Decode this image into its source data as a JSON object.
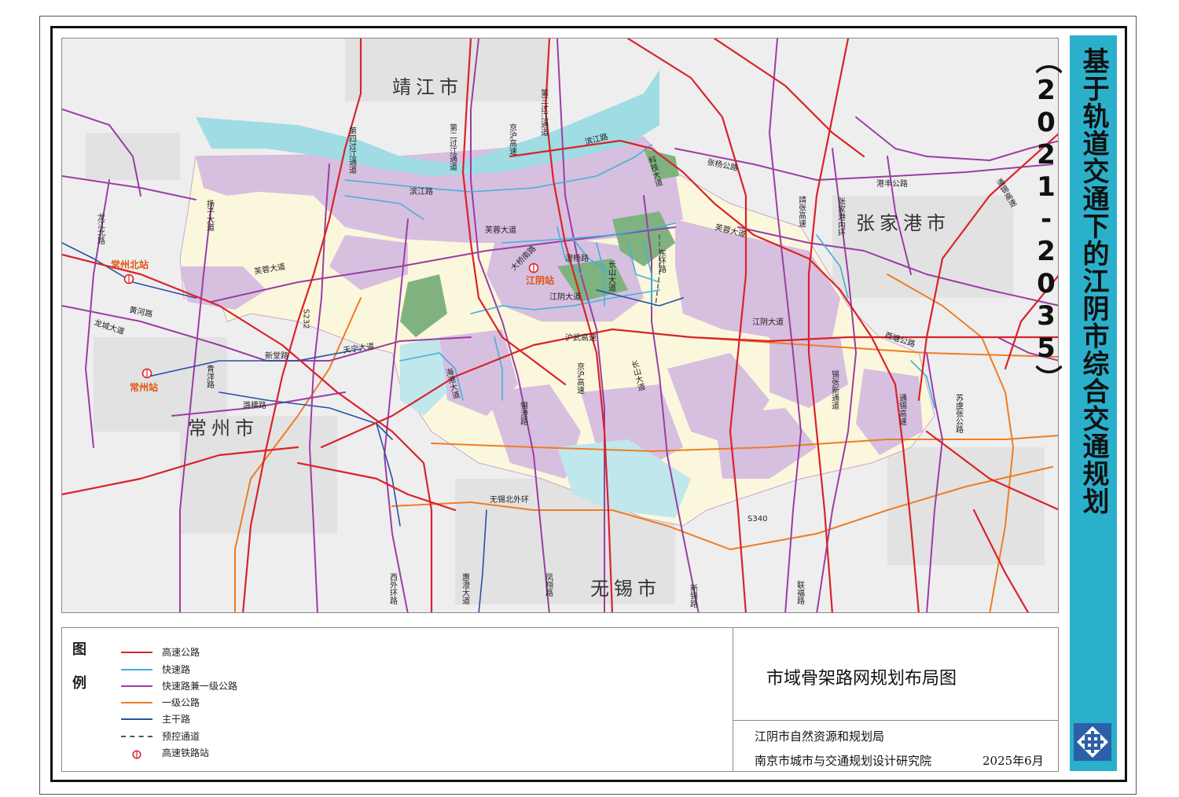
{
  "title": "基于轨道交通下的江阴市综合交通规划（2021-2035）",
  "map_title": "市域骨架路网规划布局图",
  "credits": {
    "org1": "江阴市自然资源和规划局",
    "org2": "南京市城市与交通规划设计研究院",
    "date": "2025年6月"
  },
  "legend": {
    "heading_1": "图",
    "heading_2": "例",
    "items": [
      {
        "label": "高速公路",
        "color": "#d9232a",
        "style": "solid"
      },
      {
        "label": "快速路",
        "color": "#3fb3d8",
        "style": "solid"
      },
      {
        "label": "快速路兼一级公路",
        "color": "#9b3ea4",
        "style": "solid"
      },
      {
        "label": "一级公路",
        "color": "#ee7d23",
        "style": "solid"
      },
      {
        "label": "主干路",
        "color": "#2a4fa3",
        "style": "solid"
      },
      {
        "label": "预控通道",
        "color": "#555555",
        "style": "dashed"
      },
      {
        "label": "高速铁路站",
        "color": "#d9232a",
        "style": "station"
      }
    ]
  },
  "colors": {
    "urban_area": "#d7bfe0",
    "planning_area": "#fbf7dc",
    "water": "#9fdce4",
    "green": "#7fb27f",
    "background": "#eeeeee",
    "accent_band": "#2bb0cc"
  },
  "cities": {
    "jingjiang": "靖江市",
    "zhangjiagang": "张家港市",
    "changzhou": "常州市",
    "wuxi": "无锡市"
  },
  "stations": {
    "changzhou_north": "常州北站",
    "changzhou": "常州站",
    "jiangyin": "江阴站"
  },
  "roads": {
    "longjiang_north": "龙江北路",
    "yangzi": "扬子大道",
    "huanghe": "黄河路",
    "longcheng": "龙城大道",
    "furong_w": "芙蓉大道",
    "xintang": "新堂路",
    "s232": "S232",
    "tianning": "天宁大道",
    "qingyang": "青洋路",
    "tenglong": "潞横路",
    "di4": "第四过江通道",
    "di2": "第二过江通道",
    "jinghu_n": "京沪高速",
    "di3": "第三过江通道",
    "binjiang_w": "滨江路",
    "binjiang_e": "滨江路",
    "furong_c": "芙蓉大道",
    "daqiao": "大桥南路",
    "chengyang": "澄杨路",
    "changshan_n": "长山大道",
    "jiangyin_c": "江阴大道",
    "huwu": "沪武高速",
    "haigang": "海港大道",
    "xicheng": "锡澄路",
    "jinghu_s": "京沪高速",
    "changshan_s": "长山大道",
    "kejia": "科技大道",
    "donghuan": "东环路",
    "zhangyang": "张杨公路",
    "furong_e": "芙蓉大道",
    "jiangyin_e": "江阴大道",
    "jingzhang": "靖张高速",
    "zjg_inner": "张家港内环",
    "gangfeng": "港丰公路",
    "tongxi_n": "通锡高速",
    "xitang": "西塘公路",
    "xizhang": "锡张新通道",
    "tongxi_s": "通锡高速",
    "suyuzhang": "苏虞张公路",
    "s340": "S340",
    "wuxi_ring": "无锡北外环",
    "xiwai": "西外环路",
    "huicheng": "惠澄大道",
    "fengxiang": "凤翔路",
    "xinxi": "新锡路",
    "lianfu": "联福路"
  }
}
